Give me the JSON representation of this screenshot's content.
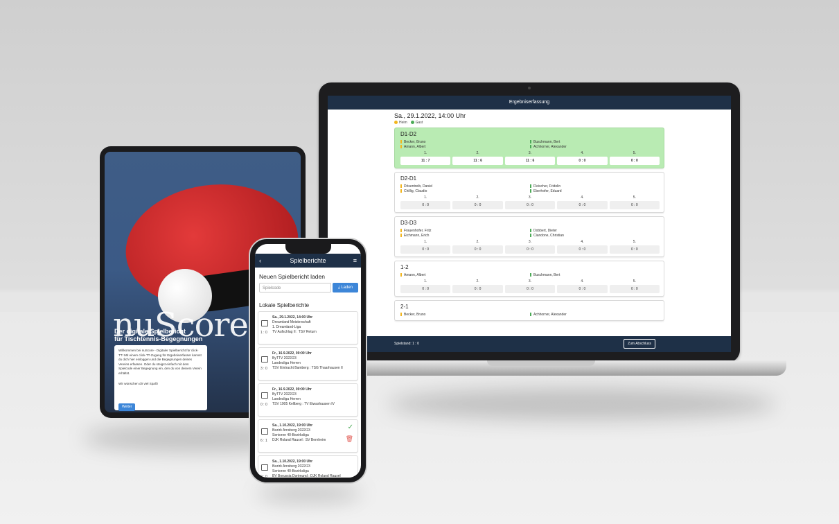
{
  "laptop": {
    "header_title": "Ergebniserfassung",
    "date": "Sa., 29.1.2022, 14:00 Uhr",
    "legend_home": "Heim",
    "legend_guest": "Gast",
    "colors": {
      "header": "#1e3047",
      "home": "#f2b51c",
      "guest": "#4caa57",
      "active": "#b9ebb3"
    },
    "games": [
      {
        "title": "D1-D2",
        "home": [
          "Becker, Bruno",
          "Amann, Albert"
        ],
        "guest": [
          "Buschmann, Bert",
          "Achhorner, Alexander"
        ],
        "sets": [
          "1.",
          "2.",
          "3.",
          "4.",
          "5."
        ],
        "scores": [
          "11 : 7",
          "11 : 6",
          "11 : 6",
          "0 : 0",
          "0 : 0"
        ]
      },
      {
        "title": "D2-D1",
        "home": [
          "Dösentreib, Daniel",
          "Chillig, Claudio"
        ],
        "guest": [
          "Fleischer, Fridolin",
          "Eberhofer, Eduard"
        ],
        "sets": [
          "1.",
          "2.",
          "3.",
          "4.",
          "5."
        ],
        "scores": [
          "0 : 0",
          "0 : 0",
          "0 : 0",
          "0 : 0",
          "0 : 0"
        ]
      },
      {
        "title": "D3-D3",
        "home": [
          "Frauenhofer, Fritz",
          "Eichmann, Erich"
        ],
        "guest": [
          "Dobbert, Dieter",
          "Ciandone, Christian"
        ],
        "sets": [
          "1.",
          "2.",
          "3.",
          "4.",
          "5."
        ],
        "scores": [
          "0 : 0",
          "0 : 0",
          "0 : 0",
          "0 : 0",
          "0 : 0"
        ]
      },
      {
        "title": "1-2",
        "home": [
          "Amann, Albert"
        ],
        "guest": [
          "Buschmann, Bert"
        ],
        "sets": [
          "1.",
          "2.",
          "3.",
          "4.",
          "5."
        ],
        "scores": [
          "0 : 0",
          "0 : 0",
          "0 : 0",
          "0 : 0",
          "0 : 0"
        ]
      },
      {
        "title": "2-1",
        "home": [
          "Becker, Bruno"
        ],
        "guest": [
          "Achhorner, Alexander"
        ],
        "sets": [],
        "scores": []
      }
    ],
    "footer_state": "Spielstand: 1 : 0",
    "footer_button": "Zum Abschluss"
  },
  "tablet": {
    "logo": "nuScore",
    "subtitle_1": "Der digitale Spielbericht",
    "subtitle_2": "für Tischtennis-Begegnungen",
    "card_text": "Willkommen bei nuScore - Digitaler Spielbericht für click-TT! Mit einem click-TT-Zugang für Ergebniserfasser kannst du dich hier einloggen und die Begegnungen deines Vereins erfassen. Oder du steigst einfach mit dem Spielcode einer Begegnung ein, den du von deinem Verein erhältst.",
    "card_wish": "Wir wünschen dir viel Spaß!",
    "button": "Weiter"
  },
  "phone": {
    "title": "Spielberichte",
    "load_heading": "Neuen Spielbericht laden",
    "input_placeholder": "Spielcode",
    "load_button": "Laden",
    "local_heading": "Lokale Spielberichte",
    "items": [
      {
        "date": "Sa., 29.1.2022, 14:00 Uhr",
        "l1": "Dreamland Meisterschaft",
        "l2": "1. Dreamland-Liga",
        "l3": "TV Aufschlag II : TSV Return",
        "score": "1 : 0"
      },
      {
        "date": "Fr., 16.9.2022, 00:00 Uhr",
        "l1": "ByTTV 2022/23",
        "l2": "Landesliga Herren",
        "l3": "TSV Eintracht Bamberg : TSG Thaarhausen II",
        "score": "3 : 0"
      },
      {
        "date": "Fr., 16.9.2022, 00:00 Uhr",
        "l1": "ByTTV 2022/23",
        "l2": "Landesliga Herren",
        "l3": "TSV 1905 Kellberg : TV Etwashausen IV",
        "score": "0 : 0"
      },
      {
        "date": "Sa., 1.10.2022, 19:00 Uhr",
        "l1": "Bezirk Arnsberg 2022/23",
        "l2": "Senioren 40-Bezirksliga",
        "l3": "DJK Roland Rauxel : SV Bernheim",
        "score": "6 : 1"
      },
      {
        "date": "Sa., 1.10.2022, 19:00 Uhr",
        "l1": "Bezirk Arnsberg 2022/23",
        "l2": "Senioren 40-Bezirksliga",
        "l3": "BV Borussia Dortmund : DJK Roland Rauxel",
        "score": "0 : 0"
      }
    ]
  }
}
